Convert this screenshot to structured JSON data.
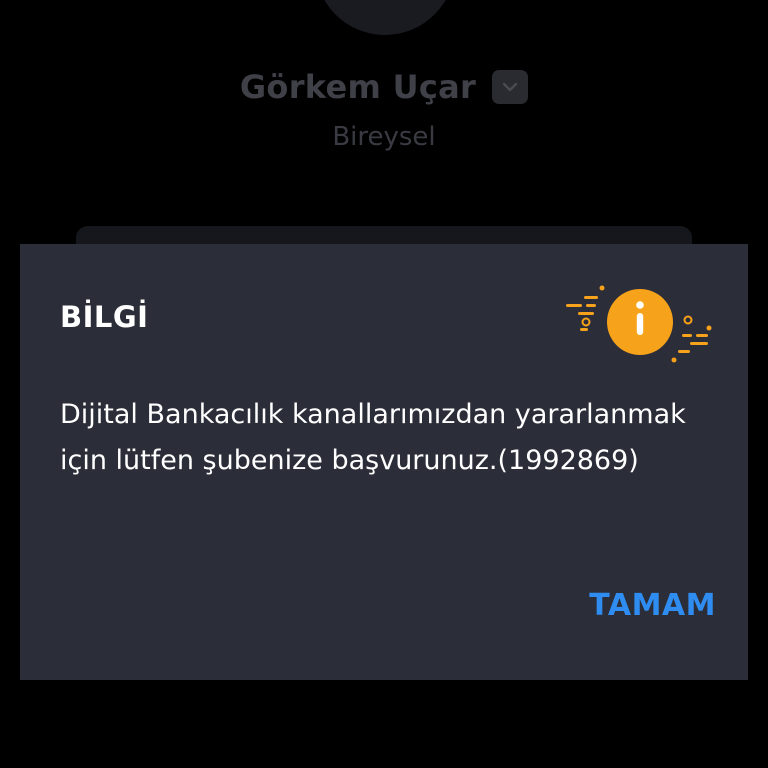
{
  "profile": {
    "name": "Görkem Uçar",
    "account_type": "Bireysel"
  },
  "dialog": {
    "title": "BİLGİ",
    "message": "Dijital Bankacılık kanallarımızdan yararlanmak için lütfen şubenize başvurunuz.(1992869)",
    "ok_label": "TAMAM",
    "icon": "info-icon"
  },
  "colors": {
    "dialog_background": "#2b2d38",
    "accent": "#2f8cf0",
    "info_orange": "#f7a21b"
  }
}
